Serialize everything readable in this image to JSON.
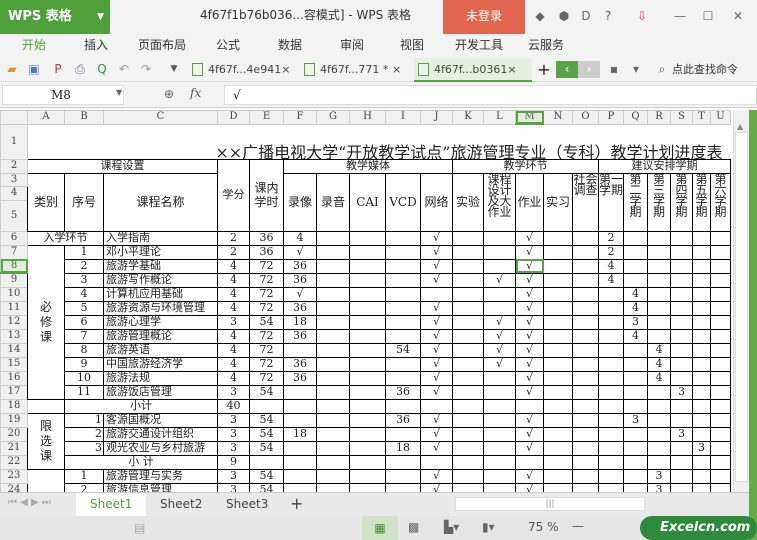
{
  "app": {
    "logo": "WPS 表格",
    "window_title": "4f67f1b76b036...容模式] - WPS 表格",
    "login": "未登录",
    "accent": "#4f9f3b",
    "login_color": "#e2664f"
  },
  "menu": [
    "开始",
    "插入",
    "页面布局",
    "公式",
    "数据",
    "审阅",
    "视图",
    "开发工具",
    "云服务"
  ],
  "doc_tabs": [
    {
      "label": "4f67f...4e941",
      "close": "×"
    },
    {
      "label": "4f67f...771 *",
      "close": "×"
    },
    {
      "label": "4f67f...b0361",
      "close": "×"
    }
  ],
  "toolbar": {
    "search_label": "点此查找命令",
    "new_tab": "+"
  },
  "formula": {
    "cell_ref": "M8",
    "fx": "fx",
    "value": "√"
  },
  "columns": [
    "A",
    "B",
    "C",
    "D",
    "E",
    "F",
    "G",
    "H",
    "I",
    "J",
    "K",
    "L",
    "M",
    "N",
    "O",
    "P",
    "Q",
    "R",
    "S",
    "T",
    "U"
  ],
  "selected_cell": "M8",
  "sheet": {
    "title": "××广播电视大学“开放教学试点”旅游管理专业（专科）教学计划进度表",
    "header": {
      "A2": "课程设置",
      "D2": "学分",
      "E2": "课内学时",
      "F2": "教学媒体",
      "K2": "教学环节",
      "P2": "建议安排学期",
      "A3": "类别",
      "B3": "序号",
      "C3": "课程名称",
      "F3": "录像",
      "G3": "录音",
      "H3": "CAI",
      "I3": "VCD",
      "J3": "网络",
      "K3": "实验",
      "L3": "课程设计及大作业",
      "M3": "作业",
      "N3": "实习",
      "O3": "社会调查",
      "P3": "第一学期",
      "Q3": "第二学期",
      "R3": "第三学期",
      "S3": "第四学期",
      "T3": "第五学期",
      "U3": "第六学期"
    },
    "rows": [
      {
        "row": 6,
        "cells": {
          "A": "入学环节",
          "C": "入学指南",
          "D": "2",
          "E": "36",
          "F": "4",
          "J": "√",
          "M": "√",
          "P": "2"
        }
      },
      {
        "row": 7,
        "cells": {
          "A": "必修课",
          "B": "1",
          "C": "邓小平理论",
          "D": "2",
          "E": "36",
          "F": "√",
          "J": "√",
          "M": "√",
          "P": "2"
        }
      },
      {
        "row": 8,
        "cells": {
          "B": "2",
          "C": "旅游学基础",
          "D": "4",
          "E": "72",
          "F": "36",
          "J": "√",
          "M": "√",
          "P": "4"
        }
      },
      {
        "row": 9,
        "cells": {
          "B": "3",
          "C": "旅游写作概论",
          "D": "4",
          "E": "72",
          "F": "36",
          "J": "√",
          "L": "√",
          "M": "√",
          "P": "4"
        }
      },
      {
        "row": 10,
        "cells": {
          "B": "4",
          "C": "计算机应用基础",
          "D": "4",
          "E": "72",
          "F": "√",
          "M": "√",
          "Q": "4"
        }
      },
      {
        "row": 11,
        "cells": {
          "B": "5",
          "C": "旅游资源与环境管理",
          "D": "4",
          "E": "72",
          "F": "36",
          "J": "√",
          "M": "√",
          "Q": "4"
        }
      },
      {
        "row": 12,
        "cells": {
          "B": "6",
          "C": "旅游心理学",
          "D": "3",
          "E": "54",
          "F": "18",
          "J": "√",
          "L": "√",
          "M": "√",
          "Q": "3"
        }
      },
      {
        "row": 13,
        "cells": {
          "B": "7",
          "C": "旅游管理概论",
          "D": "4",
          "E": "72",
          "F": "36",
          "J": "√",
          "L": "√",
          "M": "√",
          "Q": "4"
        }
      },
      {
        "row": 14,
        "cells": {
          "B": "8",
          "C": "旅游英语",
          "D": "4",
          "E": "72",
          "I": "54",
          "J": "√",
          "L": "√",
          "M": "√",
          "R": "4"
        }
      },
      {
        "row": 15,
        "cells": {
          "B": "9",
          "C": "中国旅游经济学",
          "D": "4",
          "E": "72",
          "F": "36",
          "J": "√",
          "L": "√",
          "M": "√",
          "R": "4"
        }
      },
      {
        "row": 16,
        "cells": {
          "B": "10",
          "C": "旅游法规",
          "D": "4",
          "E": "72",
          "F": "36",
          "J": "√",
          "M": "√",
          "R": "4"
        }
      },
      {
        "row": 17,
        "cells": {
          "B": "11",
          "C": "旅游饭店管理",
          "D": "3",
          "E": "54",
          "I": "36",
          "J": "√",
          "M": "√",
          "S": "3"
        }
      },
      {
        "row": 18,
        "cells": {
          "B": "小计",
          "D": "40"
        }
      },
      {
        "row": 19,
        "cells": {
          "A": "限选课",
          "B": "1",
          "C": "客源国概况",
          "D": "3",
          "E": "54",
          "I": "36",
          "J": "√",
          "M": "√",
          "Q": "3"
        }
      },
      {
        "row": 20,
        "cells": {
          "B": "2",
          "C": "旅游交通设计组织",
          "D": "3",
          "E": "54",
          "F": "18",
          "J": "√",
          "M": "√",
          "S": "3"
        }
      },
      {
        "row": 21,
        "cells": {
          "B": "3",
          "C": "观光农业与乡村旅游",
          "D": "3",
          "E": "54",
          "I": "18",
          "J": "√",
          "M": "√",
          "T": "3"
        }
      },
      {
        "row": 22,
        "cells": {
          "B": "小 计",
          "D": "9"
        }
      },
      {
        "row": 23,
        "cells": {
          "B": "1",
          "C": "旅游管理与实务",
          "D": "3",
          "E": "54",
          "J": "√",
          "M": "√",
          "R": "3"
        }
      },
      {
        "row": 24,
        "cells": {
          "B": "2",
          "C": "旅游信息管理",
          "D": "3",
          "E": "54",
          "J": "√",
          "M": "√",
          "R": "3"
        }
      }
    ]
  },
  "sheet_tabs": [
    "Sheet1",
    "Sheet2",
    "Sheet3"
  ],
  "active_sheet": "Sheet1",
  "status": {
    "zoom": "75 %"
  },
  "watermark": "Excelcn.com"
}
